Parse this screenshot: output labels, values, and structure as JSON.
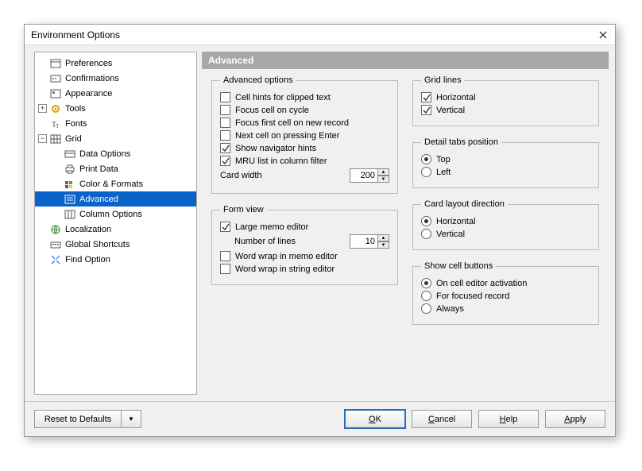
{
  "window": {
    "title": "Environment Options"
  },
  "tree": [
    {
      "label": "Preferences",
      "depth": 0,
      "expander": "none",
      "icon": "pref"
    },
    {
      "label": "Confirmations",
      "depth": 0,
      "expander": "none",
      "icon": "conf"
    },
    {
      "label": "Appearance",
      "depth": 0,
      "expander": "none",
      "icon": "appear"
    },
    {
      "label": "Tools",
      "depth": 0,
      "expander": "plus",
      "icon": "tools"
    },
    {
      "label": "Fonts",
      "depth": 0,
      "expander": "none",
      "icon": "fonts"
    },
    {
      "label": "Grid",
      "depth": 0,
      "expander": "minus",
      "icon": "grid"
    },
    {
      "label": "Data Options",
      "depth": 1,
      "expander": "none",
      "icon": "data"
    },
    {
      "label": "Print Data",
      "depth": 1,
      "expander": "none",
      "icon": "print"
    },
    {
      "label": "Color & Formats",
      "depth": 1,
      "expander": "none",
      "icon": "color"
    },
    {
      "label": "Advanced",
      "depth": 1,
      "expander": "none",
      "icon": "adv",
      "selected": true
    },
    {
      "label": "Column Options",
      "depth": 1,
      "expander": "none",
      "icon": "cols"
    },
    {
      "label": "Localization",
      "depth": 0,
      "expander": "none",
      "icon": "loc"
    },
    {
      "label": "Global Shortcuts",
      "depth": 0,
      "expander": "none",
      "icon": "keys"
    },
    {
      "label": "Find Option",
      "depth": 0,
      "expander": "none",
      "icon": "find"
    }
  ],
  "panel": {
    "title": "Advanced",
    "advanced_options": {
      "legend": "Advanced options",
      "cell_hints": {
        "label": "Cell hints for clipped text",
        "checked": false
      },
      "focus_cycle": {
        "label": "Focus cell on cycle",
        "checked": false
      },
      "focus_new": {
        "label": "Focus first cell on new record",
        "checked": false
      },
      "next_enter": {
        "label": "Next cell on pressing Enter",
        "checked": false
      },
      "nav_hints": {
        "label": "Show navigator hints",
        "checked": true
      },
      "mru": {
        "label": "MRU list in column filter",
        "checked": true
      },
      "card_width": {
        "label": "Card width",
        "value": "200"
      }
    },
    "form_view": {
      "legend": "Form view",
      "large_memo": {
        "label": "Large memo editor",
        "checked": true
      },
      "num_lines": {
        "label": "Number of lines",
        "value": "10"
      },
      "wrap_memo": {
        "label": "Word wrap in memo editor",
        "checked": false
      },
      "wrap_string": {
        "label": "Word wrap in string editor",
        "checked": false
      }
    },
    "grid_lines": {
      "legend": "Grid lines",
      "horizontal": {
        "label": "Horizontal",
        "checked": true
      },
      "vertical": {
        "label": "Vertical",
        "checked": true
      }
    },
    "detail_tabs": {
      "legend": "Detail tabs position",
      "top": {
        "label": "Top",
        "checked": true
      },
      "left": {
        "label": "Left",
        "checked": false
      }
    },
    "card_layout": {
      "legend": "Card layout direction",
      "horizontal": {
        "label": "Horizontal",
        "checked": true
      },
      "vertical": {
        "label": "Vertical",
        "checked": false
      }
    },
    "show_buttons": {
      "legend": "Show cell buttons",
      "on_activate": {
        "label": "On cell editor activation",
        "checked": true
      },
      "focused": {
        "label": "For focused record",
        "checked": false
      },
      "always": {
        "label": "Always",
        "checked": false
      }
    }
  },
  "footer": {
    "reset": "Reset to Defaults",
    "ok_pre": "O",
    "ok_post": "K",
    "cancel_pre": "C",
    "cancel_post": "ancel",
    "help_pre": "H",
    "help_post": "elp",
    "apply_pre": "A",
    "apply_post": "pply"
  }
}
